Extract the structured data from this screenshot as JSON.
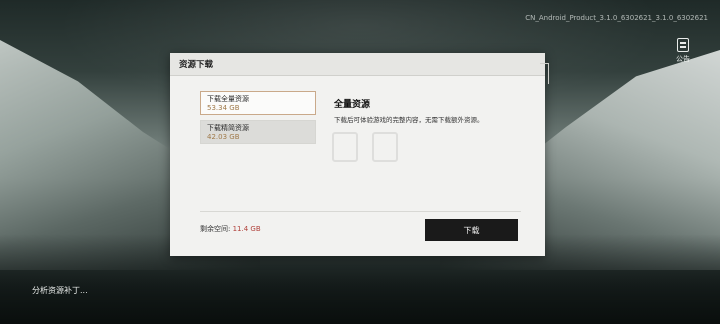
{
  "version_text": "CN_Android_Product_3.1.0_6302621_3.1.0_6302621",
  "notice": {
    "label": "公告",
    "icon": "notice-board-icon"
  },
  "status_text": "分析资源补丁...",
  "dialog": {
    "title": "资源下载",
    "options": [
      {
        "name": "下载全量资源",
        "size": "53.34 GB",
        "selected": true
      },
      {
        "name": "下载精简资源",
        "size": "42.03 GB",
        "selected": false
      }
    ],
    "detail_title": "全量资源",
    "detail_text": "下载后可体验游戏的完整内容，无需下载额外资源。",
    "space_label": "剩余空间:",
    "space_value": "11.4 GB",
    "download_label": "下载"
  },
  "colors": {
    "accent_border": "#c9a98a",
    "size_text": "#a07a4a",
    "space_value": "#b0403a",
    "button_bg": "#1a1a1a"
  }
}
